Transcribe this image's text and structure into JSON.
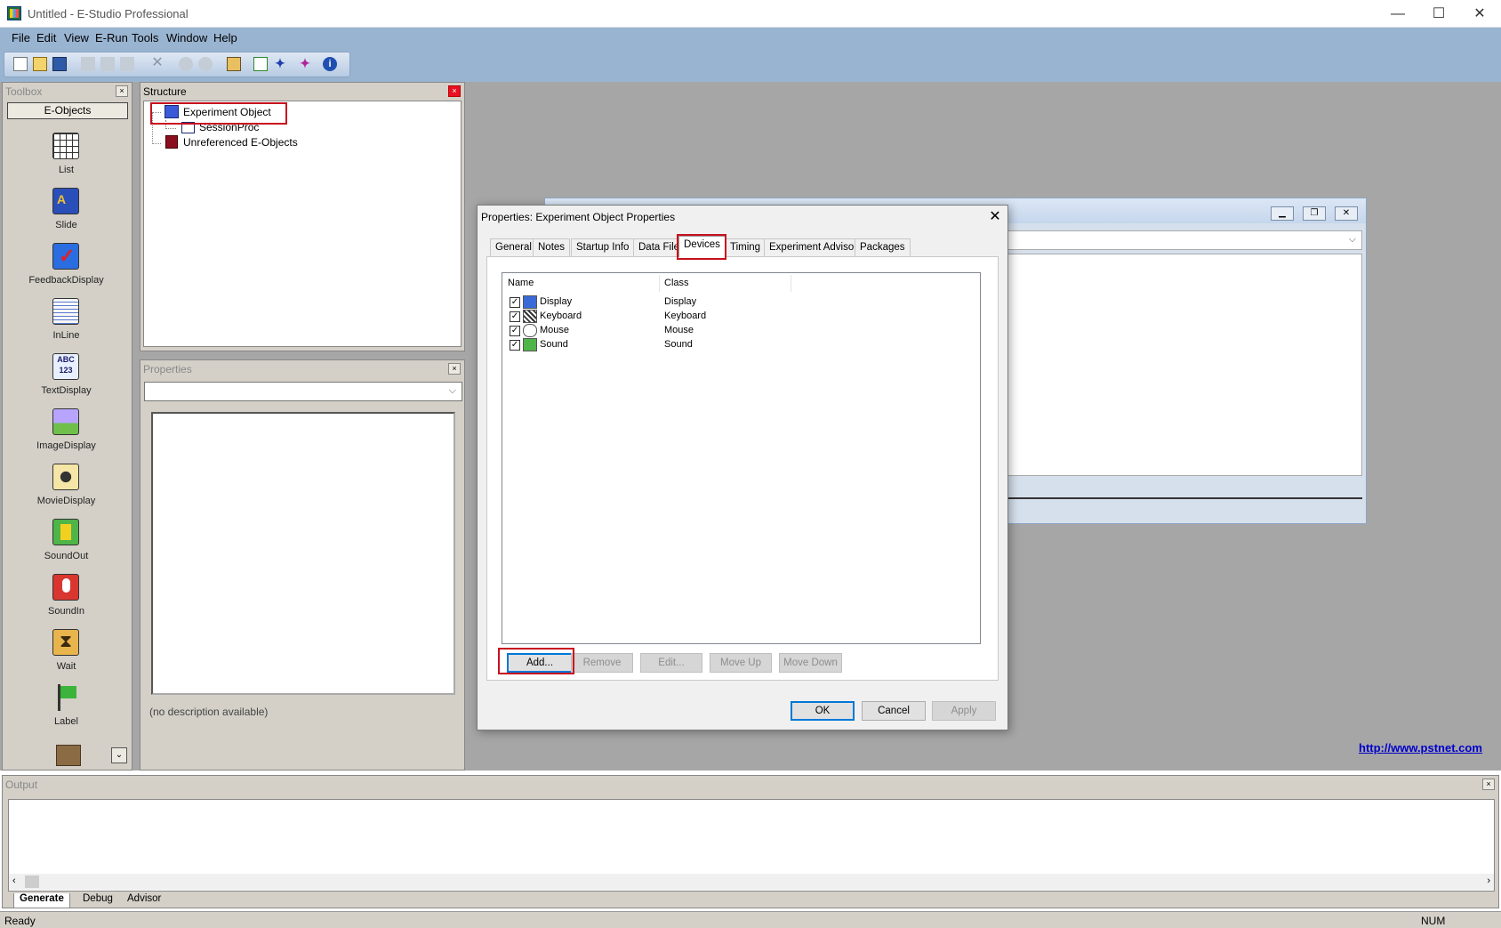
{
  "window": {
    "title": "Untitled - E-Studio Professional",
    "minimize": "—",
    "maximize": "☐",
    "close": "✕"
  },
  "menu": [
    "File",
    "Edit",
    "View",
    "E-Run",
    "Tools",
    "Window",
    "Help"
  ],
  "toolbar_icons": [
    "new-icon",
    "open-icon",
    "save-icon",
    "cut-icon",
    "copy-icon",
    "paste-icon",
    "delete-icon",
    "undo-icon",
    "redo-icon",
    "browser-icon",
    "generate-icon",
    "run-icon",
    "debug-run-icon",
    "info-icon"
  ],
  "toolbox": {
    "title": "Toolbox",
    "close": "×",
    "category": "E-Objects",
    "items": [
      {
        "label": "List",
        "icon": "list-icon",
        "color": "#ffffff"
      },
      {
        "label": "Slide",
        "icon": "slide-icon",
        "color": "#f3c32e"
      },
      {
        "label": "FeedbackDisplay",
        "icon": "feedback-checkmark-icon",
        "color": "#2a6de0"
      },
      {
        "label": "InLine",
        "icon": "inline-script-icon",
        "color": "#f7f7f7"
      },
      {
        "label": "TextDisplay",
        "icon": "text-abc-icon",
        "color": "#e8f0ff"
      },
      {
        "label": "ImageDisplay",
        "icon": "image-icon",
        "color": "#c8b4ff"
      },
      {
        "label": "MovieDisplay",
        "icon": "movie-reel-icon",
        "color": "#f5e6a8"
      },
      {
        "label": "SoundOut",
        "icon": "speaker-icon",
        "color": "#4fb548"
      },
      {
        "label": "SoundIn",
        "icon": "microphone-icon",
        "color": "#d9362f"
      },
      {
        "label": "Wait",
        "icon": "hourglass-icon",
        "color": "#e8b44c"
      },
      {
        "label": "Label",
        "icon": "flag-icon",
        "color": "#3cb43c"
      }
    ]
  },
  "structure": {
    "title": "Structure",
    "close": "×",
    "nodes": [
      "Experiment Object",
      "SessionProc",
      "Unreferenced E-Objects"
    ]
  },
  "properties_pane": {
    "title": "Properties",
    "close": "×",
    "description": "(no description available)"
  },
  "dialog": {
    "title": "Properties: Experiment Object Properties",
    "close": "✕",
    "tabs": [
      "General",
      "Notes",
      "Startup Info",
      "Data File",
      "Devices",
      "Timing",
      "Experiment Advisor",
      "Packages"
    ],
    "selected_tab": "Devices",
    "columns": [
      "Name",
      "Class"
    ],
    "devices": [
      {
        "name": "Display",
        "class": "Display",
        "checked": true
      },
      {
        "name": "Keyboard",
        "class": "Keyboard",
        "checked": true
      },
      {
        "name": "Mouse",
        "class": "Mouse",
        "checked": true
      },
      {
        "name": "Sound",
        "class": "Sound",
        "checked": true
      }
    ],
    "checkmark": "✓",
    "list_buttons": {
      "add": "Add...",
      "remove": "Remove",
      "edit": "Edit...",
      "move_up": "Move Up",
      "move_down": "Move Down"
    },
    "buttons": {
      "ok": "OK",
      "cancel": "Cancel",
      "apply": "Apply"
    }
  },
  "link": "http://www.pstnet.com",
  "output": {
    "title": "Output",
    "close": "×",
    "tabs": [
      "Generate",
      "Debug",
      "Advisor"
    ]
  },
  "status": {
    "text": "Ready",
    "num": "NUM"
  }
}
